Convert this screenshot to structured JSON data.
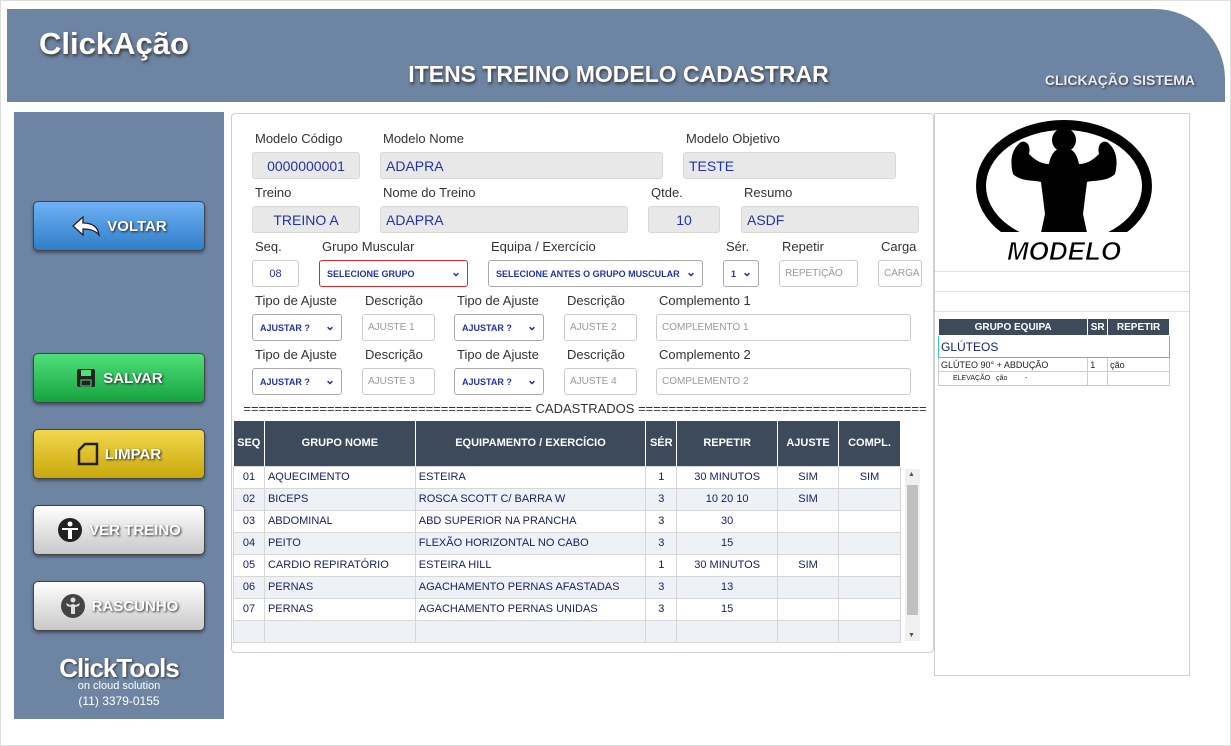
{
  "app": {
    "brand": "ClickAção",
    "page_title": "ITENS TREINO MODELO CADASTRAR",
    "system": "CLICKAÇÃO SISTEMA"
  },
  "sidebar": {
    "voltar": "VOLTAR",
    "salvar": "SALVAR",
    "limpar": "LIMPAR",
    "ver_treino": "VER TREINO",
    "rascunho": "RASCUNHO",
    "footer_logo": "ClickTools",
    "footer_tag": "on cloud solution",
    "footer_phone": "(11) 3379-0155"
  },
  "form": {
    "modelo_codigo_label": "Modelo Código",
    "modelo_codigo": "0000000001",
    "modelo_nome_label": "Modelo Nome",
    "modelo_nome": "ADAPRA",
    "modelo_objetivo_label": "Modelo Objetivo",
    "modelo_objetivo": "TESTE",
    "treino_label": "Treino",
    "treino": "TREINO A",
    "nome_treino_label": "Nome do Treino",
    "nome_treino": "ADAPRA",
    "qtde_label": "Qtde.",
    "qtde": "10",
    "resumo_label": "Resumo",
    "resumo": "ASDF",
    "seq_label": "Seq.",
    "seq": "08",
    "grupo_label": "Grupo Muscular",
    "grupo_value": "SELECIONE GRUPO",
    "equipa_label": "Equipa / Exercício",
    "equipa_value": "SELECIONE ANTES O GRUPO MUSCULAR",
    "ser_label": "Sér.",
    "ser_value": "1",
    "repetir_label": "Repetir",
    "repetir_placeholder": "REPETIÇÃO",
    "carga_label": "Carga",
    "carga_placeholder": "CARGA",
    "tipo_ajuste_label": "Tipo de Ajuste",
    "descricao_label": "Descrição",
    "ajustar_value": "AJUSTAR ?",
    "ajuste1_placeholder": "AJUSTE 1",
    "ajuste2_placeholder": "AJUSTE 2",
    "ajuste3_placeholder": "AJUSTE 3",
    "ajuste4_placeholder": "AJUSTE 4",
    "complemento1_label": "Complemento 1",
    "complemento1_placeholder": "COMPLEMENTO 1",
    "complemento2_label": "Complemento 2",
    "complemento2_placeholder": "COMPLEMENTO 2"
  },
  "divider": "====================================== CADASTRADOS ======================================",
  "table": {
    "headers": [
      "SEQ",
      "GRUPO NOME",
      "EQUIPAMENTO / EXERCÍCIO",
      "SÉR",
      "REPETIR",
      "AJUSTE",
      "COMPL."
    ],
    "rows": [
      [
        "01",
        "AQUECIMENTO",
        "ESTEIRA",
        "1",
        "30 MINUTOS",
        "SIM",
        "SIM"
      ],
      [
        "02",
        "BICEPS",
        "ROSCA SCOTT C/ BARRA W",
        "3",
        "10 20 10",
        "SIM",
        ""
      ],
      [
        "03",
        "ABDOMINAL",
        "ABD SUPERIOR NA PRANCHA",
        "3",
        "30",
        "",
        ""
      ],
      [
        "04",
        "PEITO",
        "FLEXÃO HORIZONTAL NO CABO",
        "3",
        "15",
        "",
        ""
      ],
      [
        "05",
        "CARDIO REPIRATÓRIO",
        "ESTEIRA HILL",
        "1",
        "30 MINUTOS",
        "SIM",
        ""
      ],
      [
        "06",
        "PERNAS",
        "AGACHAMENTO PERNAS AFASTADAS",
        "3",
        "13",
        "",
        ""
      ],
      [
        "07",
        "PERNAS",
        "AGACHAMENTO PERNAS UNIDAS",
        "3",
        "15",
        "",
        ""
      ],
      [
        "",
        "",
        "",
        "",
        "",
        "",
        ""
      ]
    ]
  },
  "preview": {
    "logo_text": "MODELO",
    "headers": [
      "GRUPO EQUIPA",
      "SR",
      "REPETIR"
    ],
    "group": "GLÚTEOS",
    "item_name": "GLÚTEO 90° + ABDUÇÃO",
    "item_sr": "1",
    "item_rep": "ção",
    "sub_label": "ELEVAÇÃO",
    "sub_val": "ção",
    "sub_dash": "-"
  }
}
